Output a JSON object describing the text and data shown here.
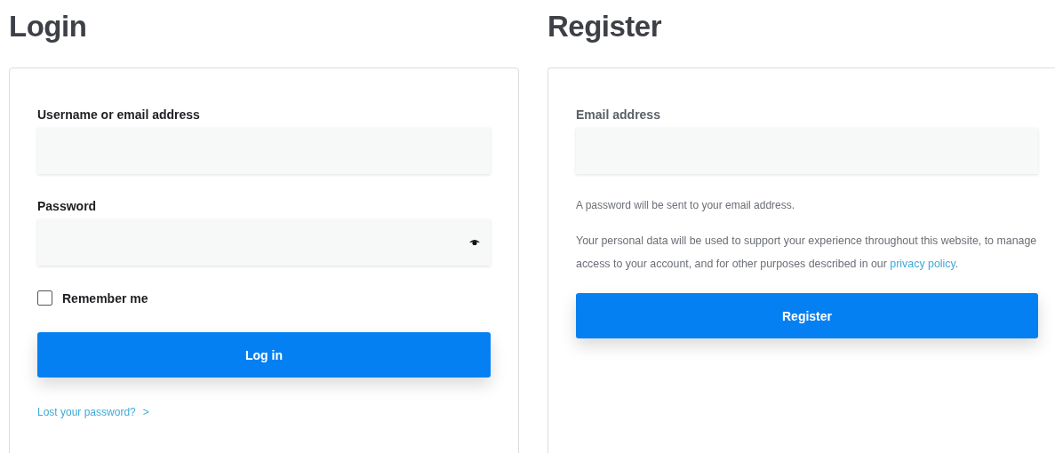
{
  "login": {
    "title": "Login",
    "fields": [
      {
        "label": "Username or email address",
        "kind": "text"
      },
      {
        "label": "Password",
        "kind": "password"
      }
    ],
    "remember": {
      "label": "Remember me",
      "checked": false
    },
    "button": "Log in",
    "lost_link": "Lost your password?",
    "lost_arrow": ">"
  },
  "register": {
    "title": "Register",
    "fields": [
      {
        "label": "Email address",
        "kind": "text"
      }
    ],
    "note": "A password will be sent to your email address.",
    "privacy_text": "Your personal data will be used to support your experience throughout this website, to manage access to your account, and for other purposes described in our",
    "privacy_link": "privacy policy",
    "privacy_end": ".",
    "button": "Register"
  }
}
